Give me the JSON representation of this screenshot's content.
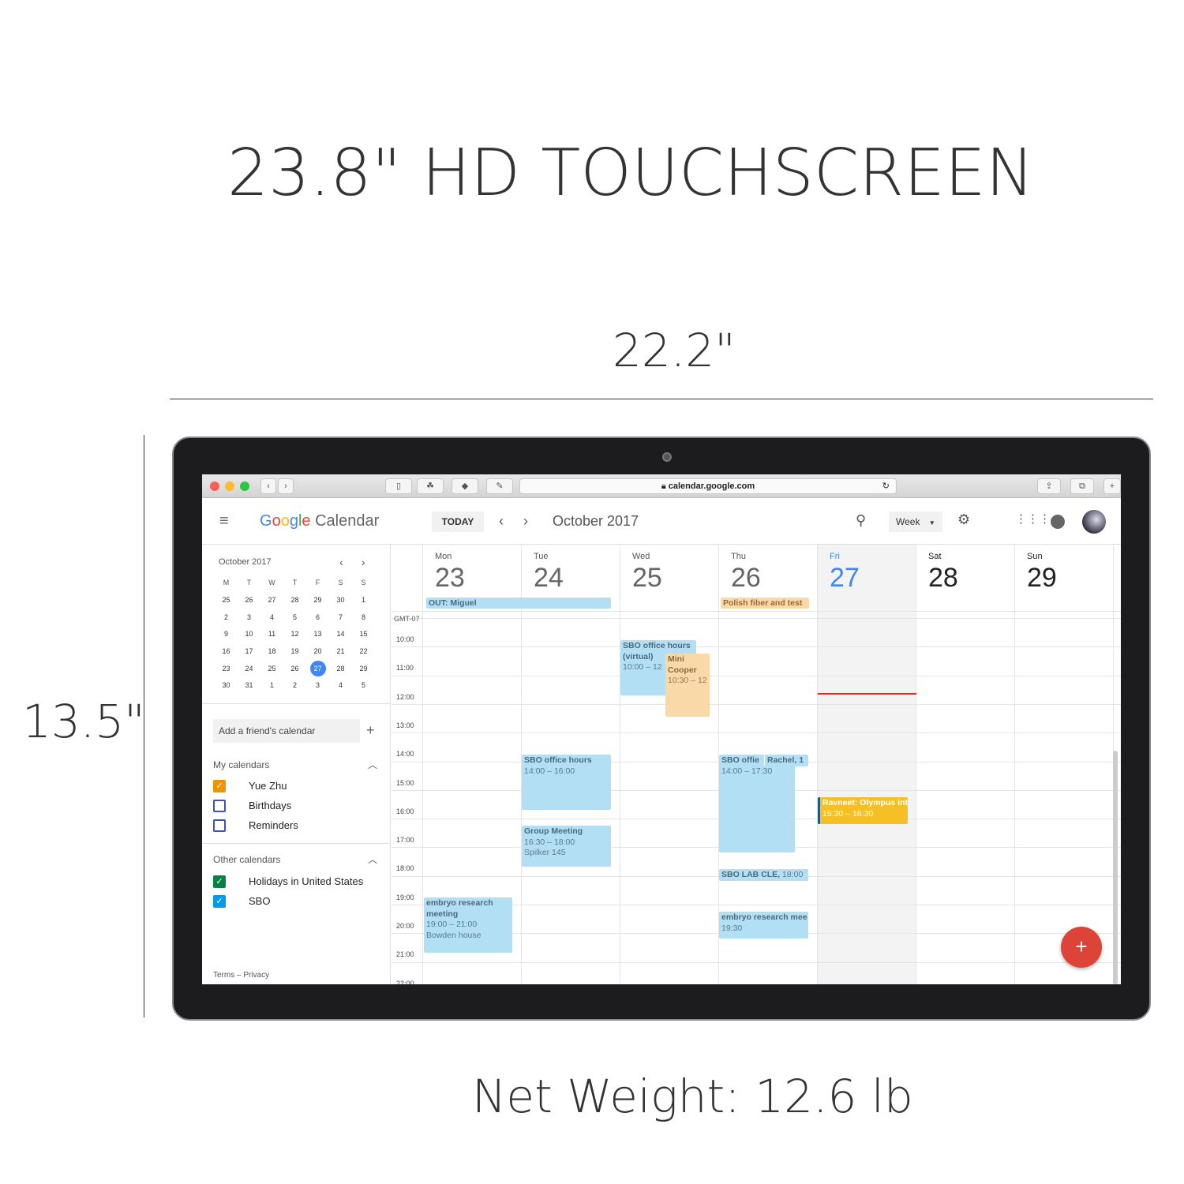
{
  "headline": "23.8\" HD TOUCHSCREEN",
  "width_label": "22.2\"",
  "height_label": "13.5\"",
  "weight_label": "Net Weight: 12.6 lb",
  "browser": {
    "url": "calendar.google.com"
  },
  "app": {
    "logo": "Google",
    "name": "Calendar",
    "today": "TODAY",
    "month": "October 2017",
    "view": "Week",
    "fab": "+"
  },
  "mini": {
    "title": "October 2017",
    "heads": [
      "M",
      "T",
      "W",
      "T",
      "F",
      "S",
      "S"
    ],
    "weeks": [
      [
        "25",
        "26",
        "27",
        "28",
        "29",
        "30",
        "1"
      ],
      [
        "2",
        "3",
        "4",
        "5",
        "6",
        "7",
        "8"
      ],
      [
        "9",
        "10",
        "11",
        "12",
        "13",
        "14",
        "15"
      ],
      [
        "16",
        "17",
        "18",
        "19",
        "20",
        "21",
        "22"
      ],
      [
        "23",
        "24",
        "25",
        "26",
        "27",
        "28",
        "29"
      ],
      [
        "30",
        "31",
        "1",
        "2",
        "3",
        "4",
        "5"
      ]
    ],
    "selected": "27"
  },
  "sidebar": {
    "add_friend": "Add a friend's calendar",
    "my_cals": "My calendars",
    "other_cals": "Other calendars",
    "my": [
      {
        "label": "Yue Zhu",
        "color": "#f09300",
        "checked": true
      },
      {
        "label": "Birthdays",
        "color": "#3f51b5",
        "checked": false
      },
      {
        "label": "Reminders",
        "color": "#3f51b5",
        "checked": false
      }
    ],
    "other": [
      {
        "label": "Holidays in United States",
        "color": "#0b8043",
        "checked": true
      },
      {
        "label": "SBO",
        "color": "#039be5",
        "checked": true
      }
    ],
    "footer": "Terms – Privacy"
  },
  "days": [
    {
      "n": "Mon",
      "d": "23"
    },
    {
      "n": "Tue",
      "d": "24"
    },
    {
      "n": "Wed",
      "d": "25"
    },
    {
      "n": "Thu",
      "d": "26"
    },
    {
      "n": "Fri",
      "d": "27"
    },
    {
      "n": "Sat",
      "d": "28"
    },
    {
      "n": "Sun",
      "d": "29"
    }
  ],
  "tz": "GMT-07",
  "hours": [
    "10:00",
    "11:00",
    "12:00",
    "13:00",
    "14:00",
    "15:00",
    "16:00",
    "17:00",
    "18:00",
    "19:00",
    "20:00",
    "21:00",
    "22:00"
  ],
  "events": {
    "e1": {
      "t": "OUT: Miguel"
    },
    "e2": {
      "t": "Polish fiber and test"
    },
    "e3": {
      "t": "SBO office hours",
      "t2": "(virtual)",
      "time": "10:00 – 12"
    },
    "e4": {
      "t": "Mini",
      "t2": "Cooper",
      "time": "10:30 – 12"
    },
    "e5": {
      "t": "SBO office hours",
      "time": "14:00 – 16:00"
    },
    "e6": {
      "t": "Group Meeting",
      "time": "16:30 – 18:00",
      "loc": "Spilker 145"
    },
    "e7": {
      "t": "embryo research",
      "t2": "meeting",
      "time": "19:00 – 21:00",
      "loc": "Bowden house"
    },
    "e8": {
      "t": "SBO offie",
      "time": "14:00 – 17:30"
    },
    "e9": {
      "t": "Rachel, 1"
    },
    "e10": {
      "t": "SBO LAB CLE,",
      "time": "18:00"
    },
    "e11": {
      "t": "embryo research mee",
      "time": "19:30"
    },
    "e12": {
      "t": "Ravneet: Olympus int",
      "time": "15:30 – 16:30"
    }
  },
  "colors": {
    "accent": "#4285f4",
    "event": "#b3dff5",
    "fab": "#db4437",
    "now_line": "#d93025",
    "orange_event": "#f6bf26"
  }
}
